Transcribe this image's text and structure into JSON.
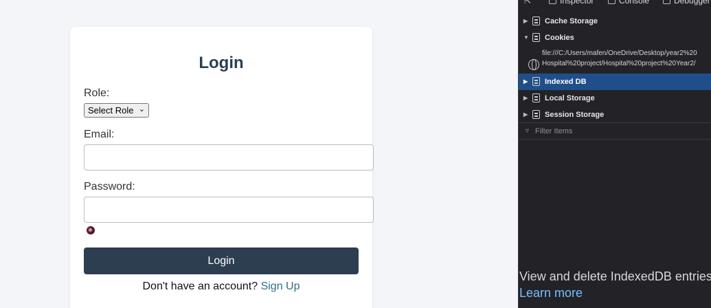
{
  "login": {
    "title": "Login",
    "role_label": "Role:",
    "role_select_value": "Select Role",
    "email_label": "Email:",
    "email_value": "",
    "password_label": "Password:",
    "password_value": "",
    "submit_label": "Login",
    "signup_prompt": "Don't have an account?",
    "signup_link": "Sign Up"
  },
  "devtools": {
    "tabs": [
      {
        "label": "Inspector",
        "icon": "inspector-icon"
      },
      {
        "label": "Console",
        "icon": "console-icon"
      },
      {
        "label": "Debugger",
        "icon": "debugger-icon"
      }
    ],
    "tree": [
      {
        "label": "Cache Storage",
        "expanded": false
      },
      {
        "label": "Cookies",
        "expanded": true
      },
      {
        "label": "Indexed DB",
        "expanded": false,
        "selected": true
      },
      {
        "label": "Local Storage",
        "expanded": false
      },
      {
        "label": "Session Storage",
        "expanded": false
      }
    ],
    "cookie_entry_line1": "file:///C:/Users/mafen/OneDrive/Desktop/year2%20",
    "cookie_entry_line2": "Hospital%20project/Hospital%20project%20Year2/",
    "filter_placeholder": "Filter Items",
    "help_text": "View and delete IndexedDB entries",
    "learn_more": "Learn more"
  },
  "colors": {
    "login_button": "#2c3e50",
    "title_text": "#2c3e50",
    "signup_link": "#2c6e8a",
    "devtools_bg": "#232327",
    "selected_row": "#204e8a",
    "learn_more_link": "#75bfff"
  }
}
